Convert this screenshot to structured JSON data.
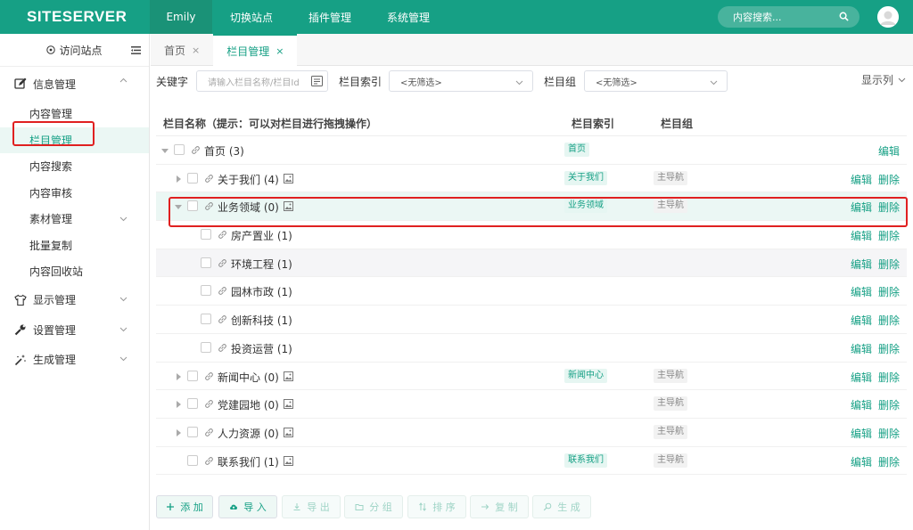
{
  "brand": {
    "logo_text": "SITESERVER",
    "accent": "#16a085",
    "annotation_color": "#e02020"
  },
  "topbar": {
    "nav": [
      {
        "label": "Emily",
        "active": true
      },
      {
        "label": "切换站点"
      },
      {
        "label": "插件管理"
      },
      {
        "label": "系统管理"
      }
    ],
    "search_placeholder": "内容搜索...",
    "avatar": "user-avatar"
  },
  "sidebar": {
    "visit_label": "访问站点",
    "groups": [
      {
        "label": "信息管理",
        "icon": "edit-icon",
        "expanded": true,
        "items": [
          "内容管理",
          "栏目管理",
          "内容搜索",
          "内容审核",
          "素材管理",
          "批量复制",
          "内容回收站"
        ]
      },
      {
        "label": "显示管理",
        "icon": "shirt-icon"
      },
      {
        "label": "设置管理",
        "icon": "wrench-icon"
      },
      {
        "label": "生成管理",
        "icon": "magic-wand-icon"
      }
    ],
    "active_item": "栏目管理"
  },
  "tabs": [
    {
      "label": "首页",
      "close": "×"
    },
    {
      "label": "栏目管理",
      "close": "×",
      "active": true
    }
  ],
  "filters": {
    "keyword_label": "关键字",
    "keyword_placeholder": "请输入栏目名称/栏目Id",
    "index_label": "栏目索引",
    "index_value": "<无筛选>",
    "group_label": "栏目组",
    "group_value": "<无筛选>",
    "columns_toggle": "显示列"
  },
  "table": {
    "headers": {
      "name": "栏目名称（提示：可以对栏目进行拖拽操作）",
      "index": "栏目索引",
      "group": "栏目组"
    },
    "edit_label": "编辑",
    "delete_label": "删除",
    "rows": [
      {
        "name": "首页 (3)",
        "level": 0,
        "expander": "expanded",
        "image": false,
        "index_tag": "首页",
        "group_tag": "",
        "delete": false
      },
      {
        "name": "关于我们 (4)",
        "level": 1,
        "expander": "collapsed",
        "image": true,
        "index_tag": "关于我们",
        "group_tag": "主导航",
        "delete": true
      },
      {
        "name": "业务领域 (0)",
        "level": 1,
        "expander": "expanded",
        "image": true,
        "index_tag": "业务领域",
        "group_tag": "主导航",
        "delete": true,
        "highlighted": true
      },
      {
        "name": "房产置业 (1)",
        "level": 2,
        "expander": "none",
        "image": false,
        "index_tag": "",
        "group_tag": "",
        "delete": true
      },
      {
        "name": "环境工程 (1)",
        "level": 2,
        "expander": "none",
        "image": false,
        "index_tag": "",
        "group_tag": "",
        "delete": true,
        "alt": true
      },
      {
        "name": "园林市政 (1)",
        "level": 2,
        "expander": "none",
        "image": false,
        "index_tag": "",
        "group_tag": "",
        "delete": true
      },
      {
        "name": "创新科技 (1)",
        "level": 2,
        "expander": "none",
        "image": false,
        "index_tag": "",
        "group_tag": "",
        "delete": true
      },
      {
        "name": "投资运营 (1)",
        "level": 2,
        "expander": "none",
        "image": false,
        "index_tag": "",
        "group_tag": "",
        "delete": true
      },
      {
        "name": "新闻中心 (0)",
        "level": 1,
        "expander": "collapsed",
        "image": true,
        "index_tag": "新闻中心",
        "group_tag": "主导航",
        "delete": true
      },
      {
        "name": "党建园地 (0)",
        "level": 1,
        "expander": "collapsed",
        "image": true,
        "index_tag": "",
        "group_tag": "主导航",
        "delete": true
      },
      {
        "name": "人力资源 (0)",
        "level": 1,
        "expander": "collapsed",
        "image": true,
        "index_tag": "",
        "group_tag": "主导航",
        "delete": true
      },
      {
        "name": "联系我们 (1)",
        "level": 1,
        "expander": "none",
        "image": true,
        "index_tag": "联系我们",
        "group_tag": "主导航",
        "delete": true
      }
    ]
  },
  "actions": [
    {
      "label": "添 加",
      "icon": "plus-icon",
      "enabled": true
    },
    {
      "label": "导 入",
      "icon": "cloud-upload-icon",
      "enabled": true
    },
    {
      "label": "导 出",
      "icon": "download-icon",
      "enabled": false
    },
    {
      "label": "分 组",
      "icon": "folder-icon",
      "enabled": false
    },
    {
      "label": "排 序",
      "icon": "sort-icon",
      "enabled": false
    },
    {
      "label": "复 制",
      "icon": "arrow-right-icon",
      "enabled": false
    },
    {
      "label": "生 成",
      "icon": "search-icon",
      "enabled": false
    }
  ]
}
